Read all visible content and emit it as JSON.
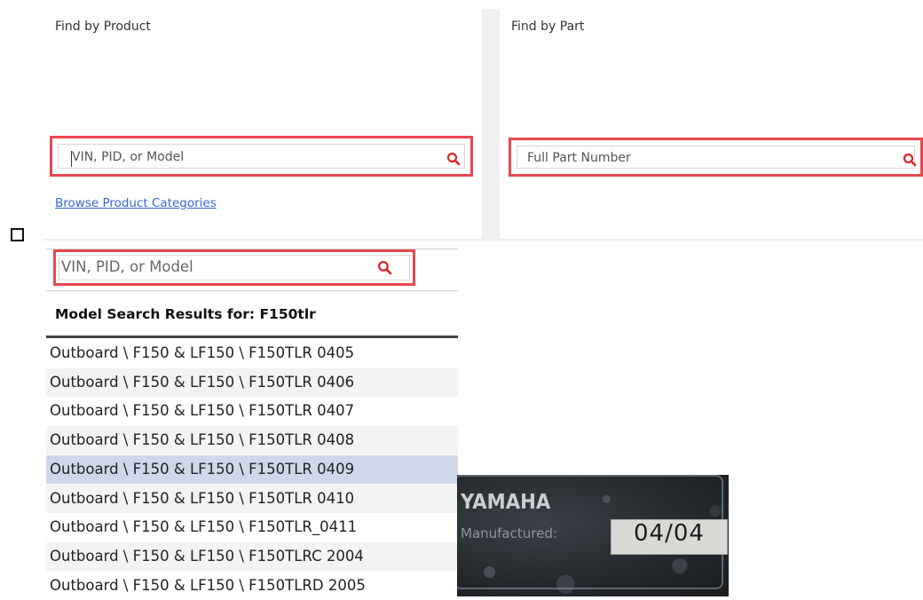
{
  "find_by_product": {
    "title": "Find by Product",
    "search_placeholder": "VIN, PID, or Model",
    "browse_link": "Browse Product Categories"
  },
  "find_by_part": {
    "title": "Find by Part",
    "search_placeholder": "Full Part Number"
  },
  "model_search": {
    "search_placeholder": "VIN, PID, or Model",
    "results_title": "Model Search Results for: F150tlr",
    "results": [
      "Outboard \\ F150 & LF150 \\ F150TLR 0405",
      "Outboard \\ F150 & LF150 \\ F150TLR 0406",
      "Outboard \\ F150 & LF150 \\ F150TLR 0407",
      "Outboard \\ F150 & LF150 \\ F150TLR 0408",
      "Outboard \\ F150 & LF150 \\ F150TLR 0409",
      "Outboard \\ F150 & LF150 \\ F150TLR 0410",
      "Outboard \\ F150 & LF150 \\ F150TLR_0411",
      "Outboard \\ F150 & LF150 \\ F150TLRC 2004",
      "Outboard \\ F150 & LF150 \\ F150TLRD 2005"
    ],
    "selected_index": 4
  },
  "label_photo": {
    "brand": "YAMAHA",
    "manufactured_label": "Manufactured:",
    "date": "04/04"
  },
  "colors": {
    "highlight_border": "#e8474f",
    "search_icon": "#d9262e",
    "link": "#3566d6",
    "selected_row": "#cfd8ea"
  }
}
